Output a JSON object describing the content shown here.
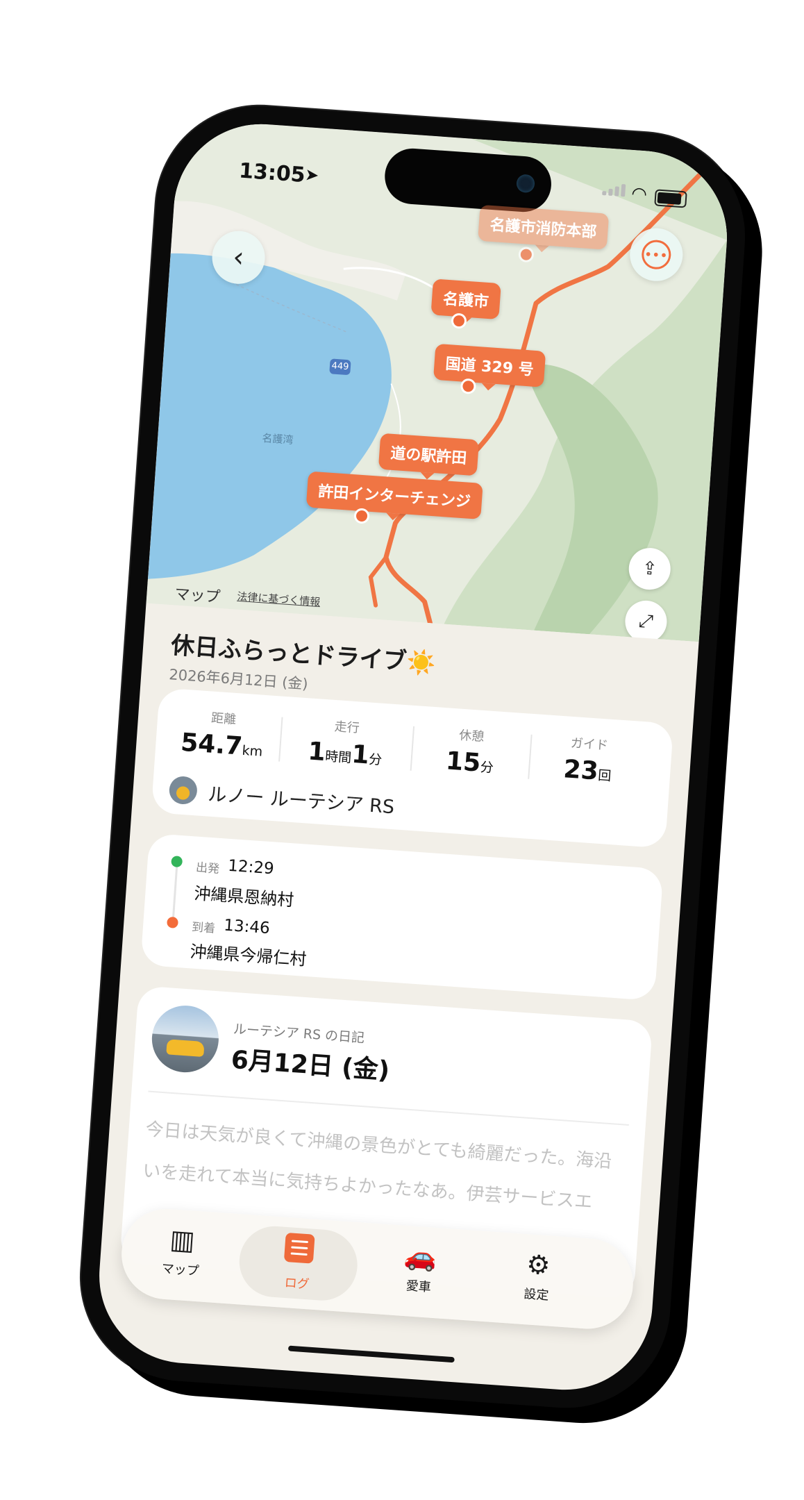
{
  "status_bar": {
    "time": "13:05"
  },
  "map": {
    "pins": [
      {
        "id": "nago-fire",
        "label": "名護市消防本部"
      },
      {
        "id": "nago-city",
        "label": "名護市"
      },
      {
        "id": "route329",
        "label": "国道 329 号"
      },
      {
        "id": "michi-no-eki",
        "label": "道の駅許田"
      },
      {
        "id": "kyoda-ic",
        "label": "許田インターチェンジ"
      }
    ],
    "bay_label": "名護湾",
    "road_shield": "449",
    "credit": "マップ",
    "legal": "法律に基づく情報"
  },
  "trip": {
    "title": "休日ふらっとドライブ☀️",
    "date": "2026年6月12日 (金)",
    "stats": [
      {
        "label": "距離",
        "value": "54.7",
        "unit": "km"
      },
      {
        "label": "走行",
        "value": "1",
        "unit": "時間",
        "value2": "1",
        "unit2": "分"
      },
      {
        "label": "休憩",
        "value": "15",
        "unit": "分"
      },
      {
        "label": "ガイド",
        "value": "23",
        "unit": "回"
      }
    ],
    "car_name": "ルノー ルーテシア RS"
  },
  "route": {
    "start": {
      "tag": "出発",
      "time": "12:29",
      "place": "沖縄県恩納村"
    },
    "end": {
      "tag": "到着",
      "time": "13:46",
      "place": "沖縄県今帰仁村"
    }
  },
  "diary": {
    "subtitle": "ルーテシア RS の日記",
    "date": "6月12日 (金)",
    "text": "今日は天気が良くて沖縄の景色がとても綺麗だった。海沿いを走れて本当に気持ちよかったなあ。伊芸サービスエ"
  },
  "tabs": [
    {
      "id": "map",
      "label": "マップ",
      "icon": "map-icon"
    },
    {
      "id": "log",
      "label": "ログ",
      "icon": "log-icon"
    },
    {
      "id": "car",
      "label": "愛車",
      "icon": "car-icon"
    },
    {
      "id": "settings",
      "label": "設定",
      "icon": "gear-icon"
    }
  ],
  "colors": {
    "accent": "#ef6a3a",
    "start": "#33b45a",
    "background": "#f2efe8"
  }
}
